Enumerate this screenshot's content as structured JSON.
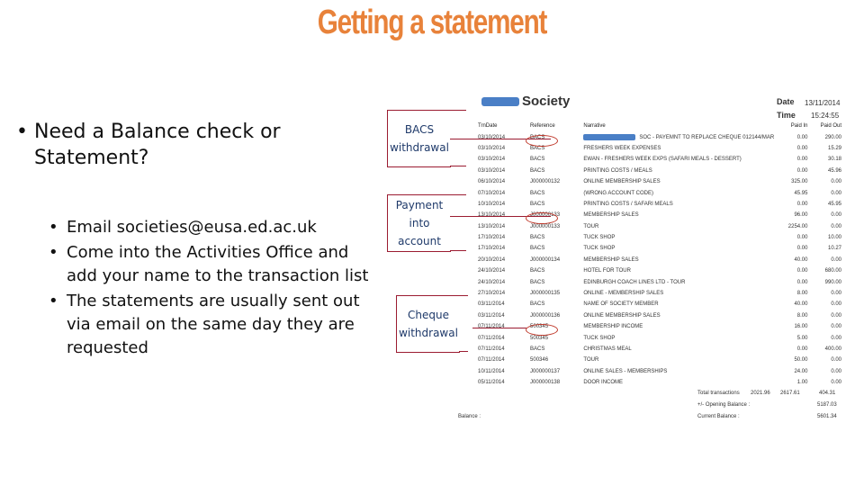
{
  "slide": {
    "title": "Getting a statement",
    "bullets": {
      "main": "Need a Balance check or Statement?",
      "sub": [
        "Email societies@eusa.ed.ac.uk",
        "Come into the Activities Office and add your name to the transaction list",
        "The statements are usually sent out via email on the same day they are requested"
      ]
    }
  },
  "callouts": [
    {
      "label": "BACS withdrawal"
    },
    {
      "label": "Payment into account"
    },
    {
      "label": "Cheque withdrawal"
    }
  ],
  "statement": {
    "society_name": "Society",
    "date_label": "Date",
    "date_value": "13/11/2014",
    "time_label": "Time",
    "time_value": "15:24:55",
    "columns": [
      "TrnDate",
      "Reference",
      "Narrative",
      "Paid In",
      "Paid Out"
    ],
    "rows": [
      {
        "date": "03/10/2014",
        "ref": "BACS",
        "narrative": "SOC - PAYEMNT TO REPLACE CHEQUE 012144/MAR",
        "paid_in": "0.00",
        "paid_out": "290.00"
      },
      {
        "date": "03/10/2014",
        "ref": "BACS",
        "narrative": "FRESHERS WEEK EXPENSES",
        "paid_in": "0.00",
        "paid_out": "15.29"
      },
      {
        "date": "03/10/2014",
        "ref": "BACS",
        "narrative": "EWAN - FRESHERS WEEK EXPS (SAFARI MEALS - DESSERT)",
        "paid_in": "0.00",
        "paid_out": "30.18"
      },
      {
        "date": "03/10/2014",
        "ref": "BACS",
        "narrative": "PRINTING COSTS / MEALS",
        "paid_in": "0.00",
        "paid_out": "45.96"
      },
      {
        "date": "06/10/2014",
        "ref": "J000000132",
        "narrative": "ONLINE MEMBERSHIP SALES",
        "paid_in": "325.00",
        "paid_out": "0.00"
      },
      {
        "date": "07/10/2014",
        "ref": "BACS",
        "narrative": "(WRONG ACCOUNT CODE)",
        "paid_in": "45.95",
        "paid_out": "0.00"
      },
      {
        "date": "10/10/2014",
        "ref": "BACS",
        "narrative": "PRINTING COSTS / SAFARI MEALS",
        "paid_in": "0.00",
        "paid_out": "45.95"
      },
      {
        "date": "13/10/2014",
        "ref": "J000000133",
        "narrative": "MEMBERSHIP SALES",
        "paid_in": "96.00",
        "paid_out": "0.00"
      },
      {
        "date": "13/10/2014",
        "ref": "J000000133",
        "narrative": "TOUR",
        "paid_in": "2254.00",
        "paid_out": "0.00"
      },
      {
        "date": "17/10/2014",
        "ref": "BACS",
        "narrative": "TUCK SHOP",
        "paid_in": "0.00",
        "paid_out": "10.00"
      },
      {
        "date": "17/10/2014",
        "ref": "BACS",
        "narrative": "TUCK SHOP",
        "paid_in": "0.00",
        "paid_out": "10.27"
      },
      {
        "date": "20/10/2014",
        "ref": "J000000134",
        "narrative": "MEMBERSHIP SALES",
        "paid_in": "40.00",
        "paid_out": "0.00"
      },
      {
        "date": "24/10/2014",
        "ref": "BACS",
        "narrative": "HOTEL FOR TOUR",
        "paid_in": "0.00",
        "paid_out": "680.00"
      },
      {
        "date": "24/10/2014",
        "ref": "BACS",
        "narrative": "EDINBURGH COACH LINES LTD - TOUR",
        "paid_in": "0.00",
        "paid_out": "990.00"
      },
      {
        "date": "27/10/2014",
        "ref": "J000000135",
        "narrative": "ONLINE - MEMBERSHIP SALES",
        "paid_in": "8.00",
        "paid_out": "0.00"
      },
      {
        "date": "03/11/2014",
        "ref": "BACS",
        "narrative": "NAME OF SOCIETY MEMBER",
        "paid_in": "40.00",
        "paid_out": "0.00"
      },
      {
        "date": "03/11/2014",
        "ref": "J000000136",
        "narrative": "ONLINE MEMBERSHIP SALES",
        "paid_in": "8.00",
        "paid_out": "0.00"
      },
      {
        "date": "07/11/2014",
        "ref": "500345",
        "narrative": "MEMBERSHIP INCOME",
        "paid_in": "16.00",
        "paid_out": "0.00"
      },
      {
        "date": "07/11/2014",
        "ref": "500345",
        "narrative": "TUCK SHOP",
        "paid_in": "5.00",
        "paid_out": "0.00"
      },
      {
        "date": "07/11/2014",
        "ref": "BACS",
        "narrative": "CHRISTMAS MEAL",
        "paid_in": "0.00",
        "paid_out": "400.00"
      },
      {
        "date": "07/11/2014",
        "ref": "500346",
        "narrative": "TOUR",
        "paid_in": "50.00",
        "paid_out": "0.00"
      },
      {
        "date": "10/11/2014",
        "ref": "J000000137",
        "narrative": "ONLINE SALES - MEMBERSHIPS",
        "paid_in": "24.00",
        "paid_out": "0.00"
      },
      {
        "date": "05/11/2014",
        "ref": "J000000138",
        "narrative": "DOOR INCOME",
        "paid_in": "1.00",
        "paid_out": "0.00"
      }
    ],
    "totals": {
      "total_label": "Total transactions",
      "total_in": "2021.96",
      "total_out": "2617.61",
      "total_net": "404.31",
      "opening_label": "+/- Opening Balance :",
      "opening_value": "5187.03",
      "current_label": "Current Balance :",
      "current_value": "5601.34",
      "balance_label": "Balance :"
    }
  }
}
